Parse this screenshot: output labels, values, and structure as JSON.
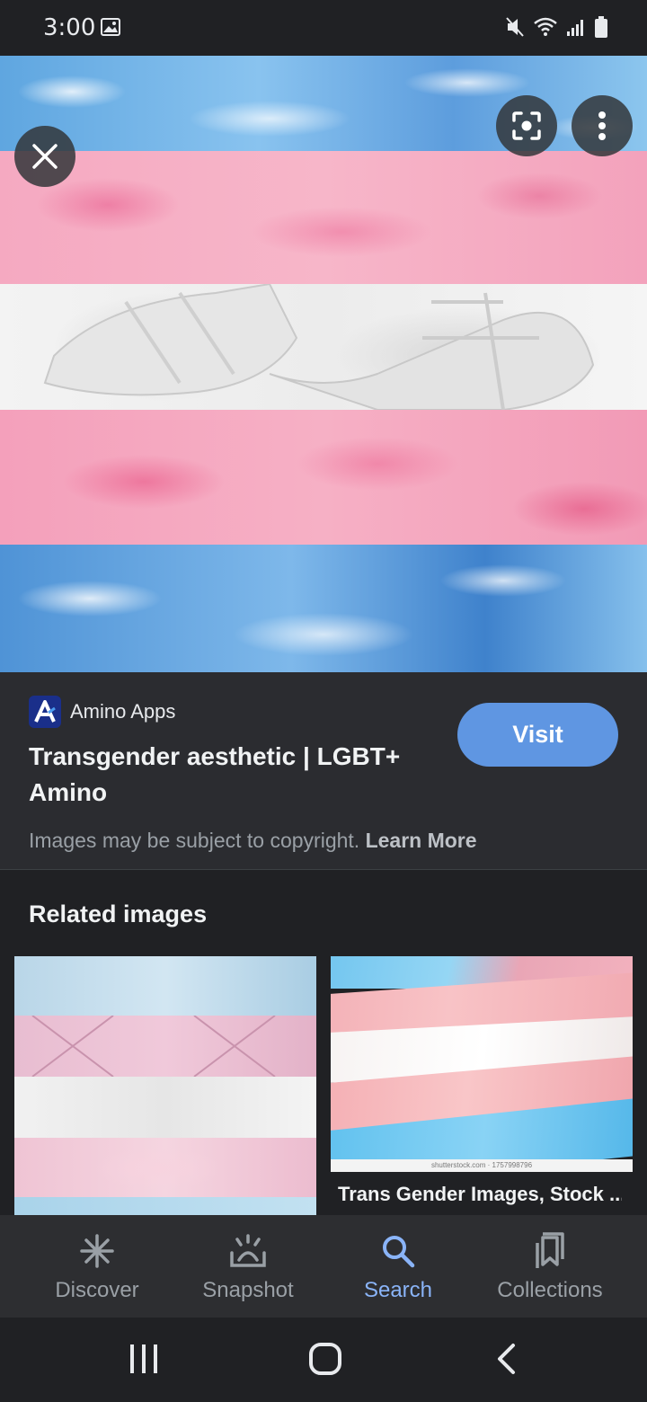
{
  "status_bar": {
    "time": "3:00"
  },
  "image_viewer": {
    "close_label": "Close",
    "lens_label": "Search inside image",
    "more_label": "More options"
  },
  "info": {
    "source_name": "Amino Apps",
    "title": "Transgender aesthetic | LGBT+ Amino",
    "visit_label": "Visit",
    "copyright_text": "Images may be subject to copyright.",
    "learn_more": "Learn More"
  },
  "related": {
    "heading": "Related images",
    "items": [
      {
        "title": ""
      },
      {
        "title": "Trans Gender Images, Stock ...",
        "watermark": "shutterstock.com · 1757998796"
      }
    ]
  },
  "bottom_nav": {
    "items": [
      {
        "label": "Discover",
        "icon": "asterisk-icon",
        "active": false
      },
      {
        "label": "Snapshot",
        "icon": "snapshot-icon",
        "active": false
      },
      {
        "label": "Search",
        "icon": "search-icon",
        "active": true
      },
      {
        "label": "Collections",
        "icon": "collections-icon",
        "active": false
      }
    ]
  },
  "colors": {
    "accent": "#8ab4f8",
    "visit_button": "#5f96e2",
    "background": "#202124",
    "trans_blue": "#5bcefa",
    "trans_pink": "#f5a9b8",
    "trans_white": "#ffffff"
  }
}
